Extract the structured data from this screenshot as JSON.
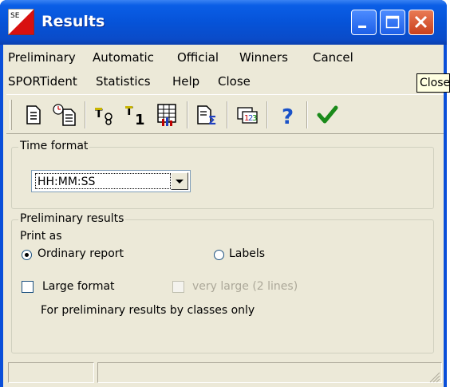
{
  "window": {
    "title": "Results"
  },
  "menu": {
    "row1": [
      "Preliminary",
      "Automatic",
      "Official",
      "Winners",
      "Cancel"
    ],
    "row2": [
      "SPORTident",
      "Statistics",
      "Help",
      "Close"
    ]
  },
  "toolbar": {
    "icons": [
      "document-icon",
      "clock-document-icon",
      "filter-first-icon",
      "rank-one-icon",
      "grid-chart-icon",
      "sum-document-icon",
      "numbered-list-icon",
      "help-icon",
      "ok-check-icon"
    ]
  },
  "time_format": {
    "legend": "Time format",
    "selected": "HH:MM:SS"
  },
  "preliminary": {
    "legend": "Preliminary results",
    "print_as": "Print as",
    "ordinary_report": "Ordinary report",
    "labels": "Labels",
    "large_format": "Large format",
    "very_large": "very large (2 lines)",
    "note": "For preliminary results by classes only"
  },
  "tooltip": {
    "text": "Close"
  },
  "colors": {
    "titlebar": "#0653d8",
    "client": "#ece9d8",
    "close_button": "#c9401d"
  }
}
